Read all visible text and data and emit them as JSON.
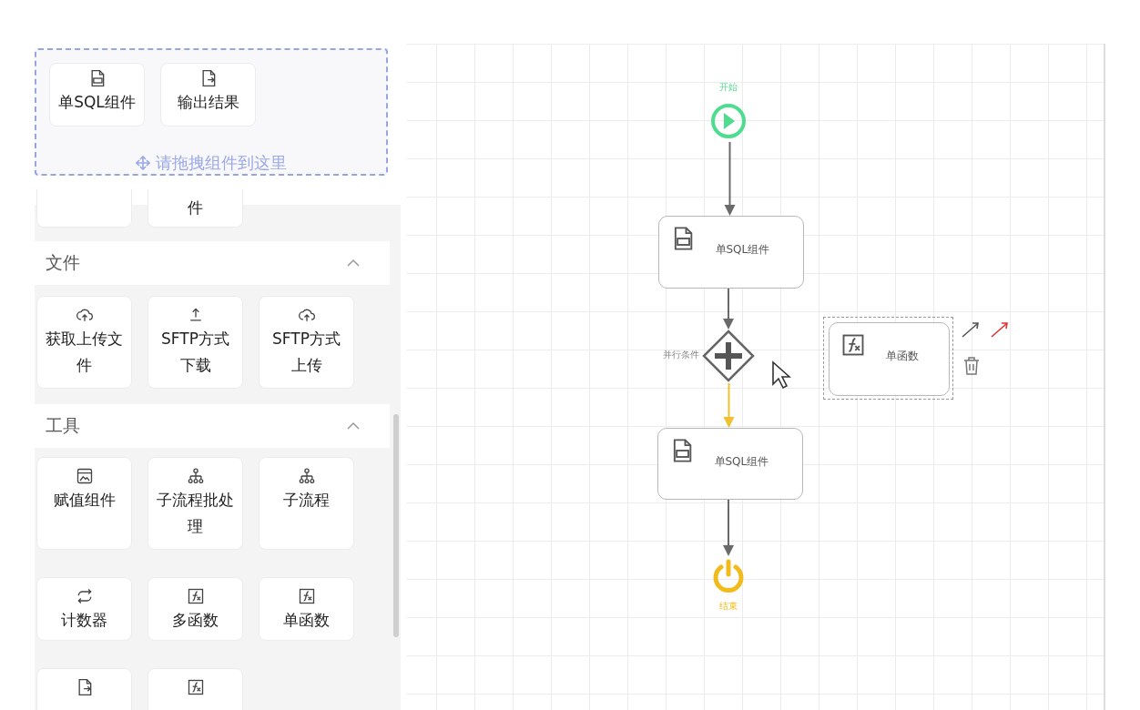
{
  "palette": {
    "drop_zone": {
      "hint": "请拖拽组件到这里",
      "items": [
        {
          "label": "单SQL组件",
          "kind": "sql"
        },
        {
          "label": "输出结果",
          "kind": "file-out"
        }
      ]
    },
    "scrolled_row": [
      {
        "kind": "blank"
      },
      {
        "kind": "text",
        "label": "件"
      }
    ],
    "sections": [
      {
        "title": "文件",
        "expanded": true,
        "items": [
          {
            "label": "获取上传文件",
            "kind": "cloud"
          },
          {
            "label": "SFTP方式下载",
            "kind": "upload"
          },
          {
            "label": "SFTP方式上传",
            "kind": "cloud"
          }
        ]
      },
      {
        "title": "工具",
        "expanded": true,
        "items": [
          {
            "label": "赋值组件",
            "kind": "image"
          },
          {
            "label": "子流程批处理",
            "kind": "org"
          },
          {
            "label": "子流程",
            "kind": "org"
          },
          {
            "label": "计数器",
            "kind": "loop"
          },
          {
            "label": "多函数",
            "kind": "fx"
          },
          {
            "label": "单函数",
            "kind": "fx"
          },
          {
            "kind": "file-out"
          },
          {
            "kind": "fx"
          }
        ]
      }
    ]
  },
  "flow": {
    "nodes": [
      {
        "kind": "start",
        "label": "开始"
      },
      {
        "kind": "sql",
        "label": "单SQL组件",
        "selected": false
      },
      {
        "kind": "gateway",
        "label": "并行条件"
      },
      {
        "kind": "sql",
        "label": "单SQL组件",
        "selected": false
      },
      {
        "kind": "end",
        "label": "结束"
      },
      {
        "kind": "fx",
        "label": "单函数",
        "selected": true
      }
    ],
    "edges": [
      {
        "active": false
      },
      {
        "active": false
      },
      {
        "active": true
      },
      {
        "active": false
      }
    ]
  }
}
